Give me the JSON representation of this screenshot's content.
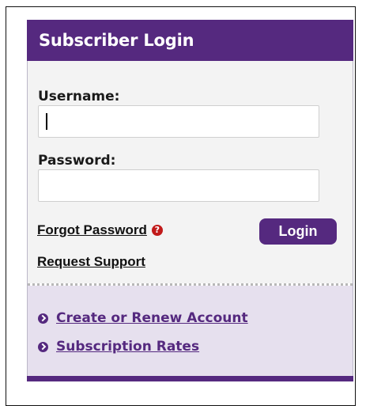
{
  "login_panel": {
    "title": "Subscriber Login",
    "username_label": "Username:",
    "username_value": "",
    "password_label": "Password:",
    "password_value": "",
    "forgot_password": "Forgot Password",
    "help_icon": "question-mark-icon",
    "login_button": "Login",
    "request_support": "Request Support"
  },
  "account_links": [
    {
      "label": "Create or Renew Account",
      "icon": "chevron-right-circle-icon"
    },
    {
      "label": "Subscription Rates",
      "icon": "chevron-right-circle-icon"
    }
  ],
  "colors": {
    "brand_purple": "#55297f",
    "help_red": "#c11a1a",
    "form_background": "#f3f3f3",
    "links_background": "#e6e0ee"
  }
}
